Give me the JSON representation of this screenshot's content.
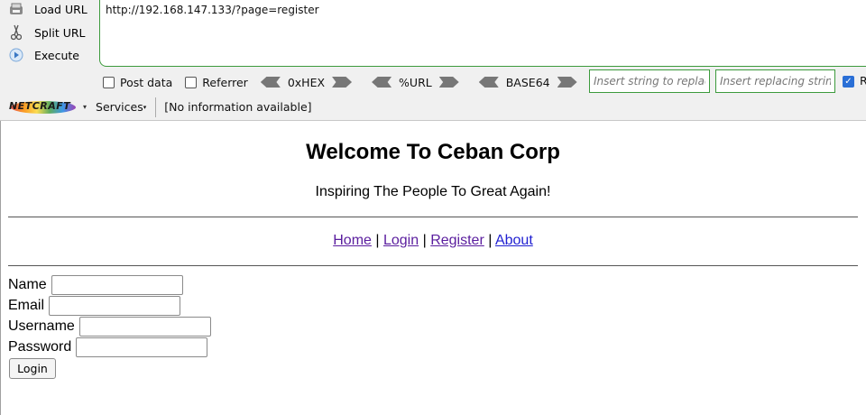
{
  "hackbar": {
    "actions": [
      {
        "label": "Load URL",
        "icon": "load-url-icon"
      },
      {
        "label": "Split URL",
        "icon": "scissors-icon"
      },
      {
        "label": "Execute",
        "icon": "play-icon"
      }
    ],
    "url": "http://192.168.147.133/?page=register",
    "post_data_label": "Post data",
    "referrer_label": "Referrer",
    "encoders": [
      "0xHEX",
      "%URL",
      "BASE64"
    ],
    "replace_placeholder": "Insert string to replace",
    "replacing_placeholder": "Insert replacing string",
    "trailing_label": "R",
    "accent_color": "#3c9a3c"
  },
  "netcraft": {
    "logo_text": "NETCRAFT",
    "services_label": "Services",
    "info_text": "[No information available]"
  },
  "page": {
    "title": "Welcome To Ceban Corp",
    "tagline": "Inspiring The People To Great Again!",
    "nav": [
      {
        "label": "Home"
      },
      {
        "label": "Login"
      },
      {
        "label": "Register"
      },
      {
        "label": "About"
      }
    ],
    "nav_separator": "|",
    "form": {
      "fields": [
        {
          "label": "Name",
          "value": ""
        },
        {
          "label": "Email",
          "value": ""
        },
        {
          "label": "Username",
          "value": ""
        },
        {
          "label": "Password",
          "value": ""
        }
      ],
      "submit_label": "Login"
    }
  }
}
